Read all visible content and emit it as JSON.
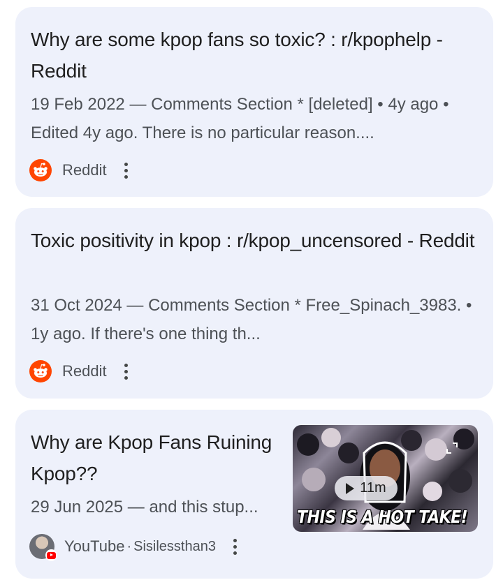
{
  "results": [
    {
      "title": "Why are some kpop fans so toxic? : r/kpophelp - Reddit",
      "snippet": "19 Feb 2022 — Comments Section * [deleted] • 4y ago • Edited 4y ago. There is no particular reason....",
      "source": "Reddit",
      "icon": "reddit-icon"
    },
    {
      "title": "Toxic positivity in kpop : r/kpop_uncensored - Reddit",
      "snippet": "31 Oct 2024 — Comments Section * Free_Spinach_3983. • 1y ago. If there's one thing th...",
      "source": "Reddit",
      "icon": "reddit-icon"
    },
    {
      "title": "Why are Kpop Fans Ruining Kpop??",
      "snippet": "29 Jun 2025 — and this stup...",
      "source": "YouTube",
      "separator": "·",
      "channel": "Sisilessthan3",
      "icon": "youtube-icon",
      "video": {
        "duration": "11m",
        "caption": "THIS IS A HOT TAKE!"
      }
    }
  ],
  "colors": {
    "card_bg": "#eef1fb",
    "reddit": "#ff4500",
    "youtube": "#ff0000",
    "title": "#1f1f1f",
    "snippet": "#4d5156"
  }
}
